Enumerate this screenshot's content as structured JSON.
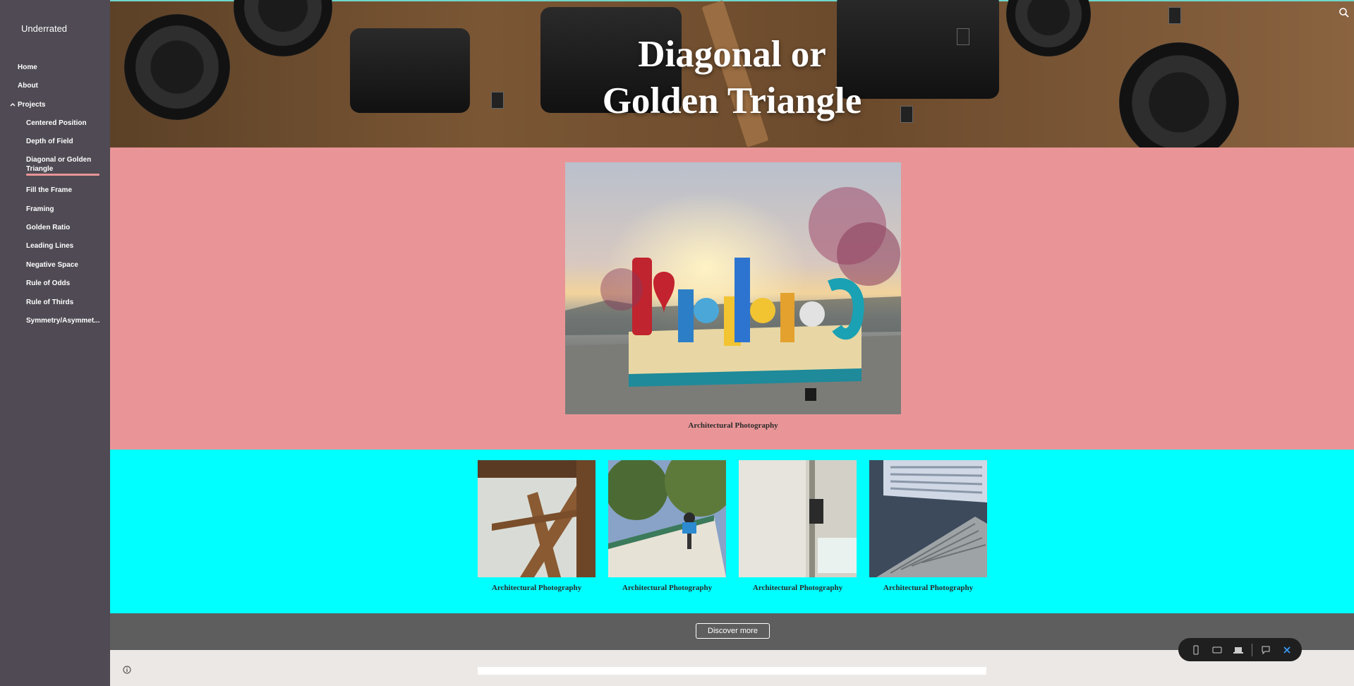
{
  "site": {
    "title": "Underrated"
  },
  "nav": {
    "home": "Home",
    "about": "About",
    "projects": "Projects",
    "subitems": [
      "Centered Position",
      "Depth of Field",
      "Diagonal or Golden Triangle",
      "Fill the Frame",
      "Framing",
      "Golden Ratio",
      "Leading Lines",
      "Negative Space",
      "Rule of Odds",
      "Rule of Thirds",
      "Symmetry/Asymmet..."
    ],
    "active": "Diagonal or Golden Triangle"
  },
  "hero": {
    "title_line1": "Diagonal or",
    "title_line2": "Golden Triangle"
  },
  "feature": {
    "caption": "Architectural Photography"
  },
  "gallery": {
    "captions": [
      "Architectural Photography",
      "Architectural Photography",
      "Architectural Photography",
      "Architectural Photography"
    ]
  },
  "discover": {
    "button_label": "Discover more"
  },
  "colors": {
    "sidebar": "#4f4a53",
    "feature_bg": "#e99597",
    "gallery_bg": "#00ffff",
    "discover_bg": "#5e5e5e",
    "accent": "#e99597"
  },
  "icons": {
    "search": "search-icon",
    "info": "info-icon",
    "chevron": "chevron-up-icon",
    "toolbar": [
      "phone-icon",
      "tablet-icon",
      "laptop-icon",
      "feedback-icon",
      "close-icon"
    ]
  }
}
